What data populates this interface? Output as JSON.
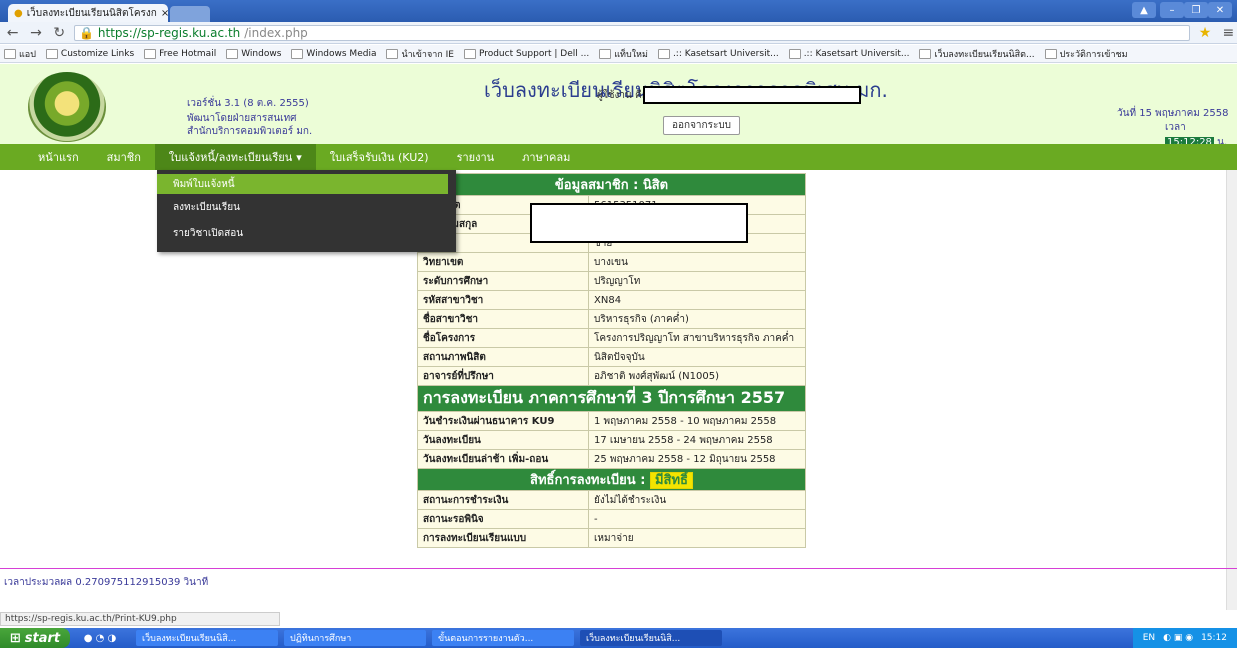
{
  "browser": {
    "tab_title": "เว็บลงทะเบียนเรียนนิสิตโครงก",
    "tab_close": "×",
    "url_scheme": "https://",
    "url_host": "sp-regis.ku.ac.th",
    "url_path": "/index.php",
    "bookmarks": [
      "แอป",
      "Customize Links",
      "Free Hotmail",
      "Windows",
      "Windows Media",
      "นำเข้าจาก IE",
      "Product Support | Dell ...",
      "แท็บใหม่",
      ".:: Kasetsart Universit...",
      ".:: Kasetsart Universit...",
      "เว็บลงทะเบียนเรียนนิสิต...",
      "ประวัติการเข้าชม"
    ],
    "status_url": "https://sp-regis.ku.ac.th/Print-KU9.php"
  },
  "header": {
    "site_title": "เว็บลงทะเบียนเรียนนิสิตโครงการภาคพิเศษ มก.",
    "version": "เวอร์ชั่น 3.1 (8 ต.ค. 2555)",
    "developer_line1": "พัฒนาโดยฝ่ายสารสนเทศ",
    "developer_line2": "สำนักบริการคอมพิวเตอร์ มก.",
    "user_label": "ผู้ใช้งาน คือ",
    "logout_label": "ออกจากระบบ",
    "date_text": "วันที่ 15 พฤษภาคม 2558",
    "time_prefix": "เวลา",
    "time_value": "15:12:28",
    "time_suffix": "น."
  },
  "nav": {
    "items": [
      "หน้าแรก",
      "สมาชิก",
      "ใบแจ้งหนี้/ลงทะเบียนเรียน",
      "ใบเสร็จรับเงิน (KU2)",
      "รายงาน",
      "ภาษาคลม"
    ],
    "dropdown_caret": "▾",
    "dropdown": [
      "พิมพ์ใบแจ้งหนี้",
      "ลงทะเบียนเรียน",
      "รายวิชาเปิดสอน"
    ]
  },
  "member": {
    "section_title": "ข้อมูลสมาชิก : นิสิต",
    "rows": [
      {
        "label": "รหัสนิสิต",
        "value": "5615351071"
      },
      {
        "label": "ชื่อ-นามสกุล",
        "value": ""
      },
      {
        "label": "เพศ",
        "value": "ชาย"
      },
      {
        "label": "วิทยาเขต",
        "value": "บางเขน"
      },
      {
        "label": "ระดับการศึกษา",
        "value": "ปริญญาโท"
      },
      {
        "label": "รหัสสาขาวิชา",
        "value": "XN84"
      },
      {
        "label": "ชื่อสาขาวิชา",
        "value": "บริหารธุรกิจ (ภาคค่ำ)"
      },
      {
        "label": "ชื่อโครงการ",
        "value": "โครงการปริญญาโท สาขาบริหารธุรกิจ ภาคค่ำ"
      },
      {
        "label": "สถานภาพนิสิต",
        "value": "นิสิตปัจจุบัน"
      },
      {
        "label": "อาจารย์ที่ปรึกษา",
        "value": "อภิชาติ พงศ์สุพัฒน์ (N1005)"
      }
    ],
    "registration_title": "การลงทะเบียน ภาคการศึกษาที่ 3 ปีการศึกษา 2557",
    "registration_rows": [
      {
        "label": "วันชำระเงินผ่านธนาคาร KU9",
        "value": "1 พฤษภาคม 2558 - 10 พฤษภาคม 2558"
      },
      {
        "label": "วันลงทะเบียน",
        "value": "17 เมษายน 2558 - 24 พฤษภาคม 2558"
      },
      {
        "label": "วันลงทะเบียนล่าช้า เพิ่ม-ถอน",
        "value": "25 พฤษภาคม 2558 - 12 มิถุนายน 2558"
      }
    ],
    "rights_title": "สิทธิ์การลงทะเบียน :",
    "rights_badge": "มีสิทธิ์",
    "rights_rows": [
      {
        "label": "สถานะการชำระเงิน",
        "value": "ยังไม่ได้ชำระเงิน"
      },
      {
        "label": "สถานะรอพินิจ",
        "value": "-"
      },
      {
        "label": "การลงทะเบียนเรียนแบบ",
        "value": "เหมาจ่าย"
      }
    ]
  },
  "footer": {
    "processing_time": "เวลาประมวลผล 0.270975112915039 วินาที"
  },
  "taskbar": {
    "start": "start",
    "tasks": [
      "เว็บลงทะเบียนเรียนนิสิ...",
      "ปฏิทินการศึกษา",
      "ขั้นตอนการรายงานตัว...",
      "เว็บลงทะเบียนเรียนนิสิ..."
    ],
    "lang": "EN",
    "clock": "15:12"
  }
}
